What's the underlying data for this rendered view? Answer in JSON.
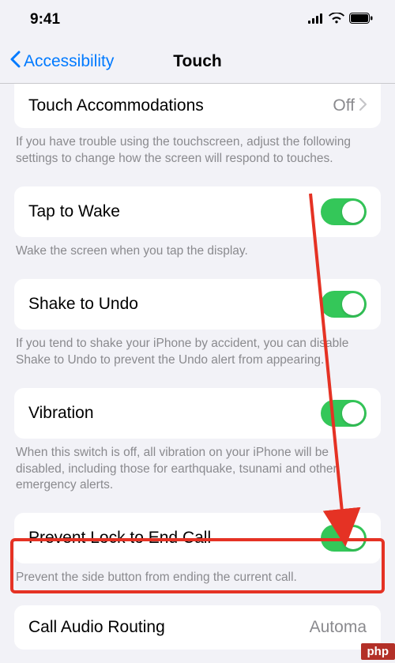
{
  "status": {
    "time": "9:41"
  },
  "nav": {
    "back_label": "Accessibility",
    "title": "Touch"
  },
  "groups": {
    "touch_accom": {
      "label": "Touch Accommodations",
      "value": "Off",
      "footer": "If you have trouble using the touchscreen, adjust the following settings to change how the screen will respond to touches."
    },
    "tap_to_wake": {
      "label": "Tap to Wake",
      "footer": "Wake the screen when you tap the display."
    },
    "shake_to_undo": {
      "label": "Shake to Undo",
      "footer": "If you tend to shake your iPhone by accident, you can disable Shake to Undo to prevent the Undo alert from appearing."
    },
    "vibration": {
      "label": "Vibration",
      "footer": "When this switch is off, all vibration on your iPhone will be disabled, including those for earthquake, tsunami and other emergency alerts."
    },
    "prevent_lock": {
      "label": "Prevent Lock to End Call",
      "footer": "Prevent the side button from ending the current call."
    },
    "call_audio": {
      "label": "Call Audio Routing",
      "value": "Automa"
    }
  },
  "watermark": "php"
}
